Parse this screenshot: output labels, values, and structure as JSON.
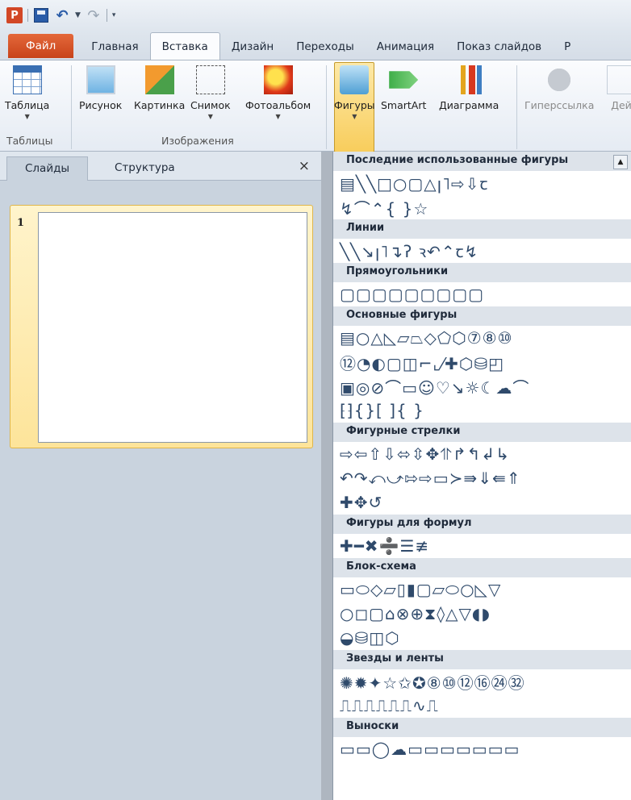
{
  "qat": {
    "app_letter": "P",
    "undo_icon": "undo-icon",
    "redo_icon": "redo-icon"
  },
  "tabs": [
    {
      "label": "Файл"
    },
    {
      "label": "Главная"
    },
    {
      "label": "Вставка"
    },
    {
      "label": "Дизайн"
    },
    {
      "label": "Переходы"
    },
    {
      "label": "Анимация"
    },
    {
      "label": "Показ слайдов"
    },
    {
      "label": "Р"
    }
  ],
  "ribbon": {
    "buttons": [
      {
        "label": "Таблица",
        "icon": "table-icon"
      },
      {
        "label": "Рисунок",
        "icon": "picture-icon"
      },
      {
        "label": "Картинка",
        "icon": "clipart-icon"
      },
      {
        "label": "Снимок",
        "icon": "screenshot-icon"
      },
      {
        "label": "Фотоальбом",
        "icon": "photo-album-icon"
      },
      {
        "label": "Фигуры",
        "icon": "shapes-icon"
      },
      {
        "label": "SmartArt",
        "icon": "smartart-icon"
      },
      {
        "label": "Диаграмма",
        "icon": "chart-icon"
      },
      {
        "label": "Гиперссылка",
        "icon": "hyperlink-icon"
      },
      {
        "label": "Дей",
        "icon": "action-icon"
      }
    ],
    "groups": {
      "tables": "Таблицы",
      "images": "Изображения"
    }
  },
  "pane": {
    "tab_slides": "Слайды",
    "tab_outline": "Структура",
    "close": "×",
    "slide_number": "1"
  },
  "gallery": {
    "sections": [
      {
        "title": "Последние использованные фигуры",
        "rows": [
          "▤╲╲□○▢△ꞁ˥⇨⇩ꞇ",
          "↯⌒⌃{ }☆"
        ]
      },
      {
        "title": "Линии",
        "rows": [
          "╲╲↘ꞁ˥↴ʔ ꝛ↶⌃ꞇ↯"
        ]
      },
      {
        "title": "Прямоугольники",
        "rows": [
          "▢▢▢▢▢▢▢▢▢"
        ]
      },
      {
        "title": "Основные фигуры",
        "rows": [
          "▤○△◺▱⏢◇⬠⬡⑦⑧⑩",
          "⑫◔◐▢◫⌐⌞⁄✚⬡⛁◰",
          "▣◎⊘⌒▭☺♡↘☼☾☁⌒",
          "⁅⁆{}[ ]{ }"
        ]
      },
      {
        "title": "Фигурные стрелки",
        "rows": [
          "⇨⇦⇧⇩⬄⇳✥⥣↱↰↲↳",
          "↶↷⤺⤻⇰⇨▭≻⇛⇓⇚⇑",
          "✚✥↺"
        ]
      },
      {
        "title": "Фигуры для формул",
        "rows": [
          "✚━✖➗☰≢"
        ]
      },
      {
        "title": "Блок-схема",
        "rows": [
          "▭⬭◇▱▯▮▢▱⬭○◺▽",
          "○◻▢⌂⊗⊕⧗◊△▽◖◗",
          "◒⛁◫⬡"
        ]
      },
      {
        "title": "Звезды и ленты",
        "rows": [
          "✺✹✦☆✩✪⑧⑩⑫⑯㉔㉜",
          "⎍⎍⎍⎍⎍⎍∿⎍"
        ]
      },
      {
        "title": "Выноски",
        "rows": [
          "▭▭◯☁▭▭▭▭▭▭▭"
        ]
      }
    ]
  }
}
